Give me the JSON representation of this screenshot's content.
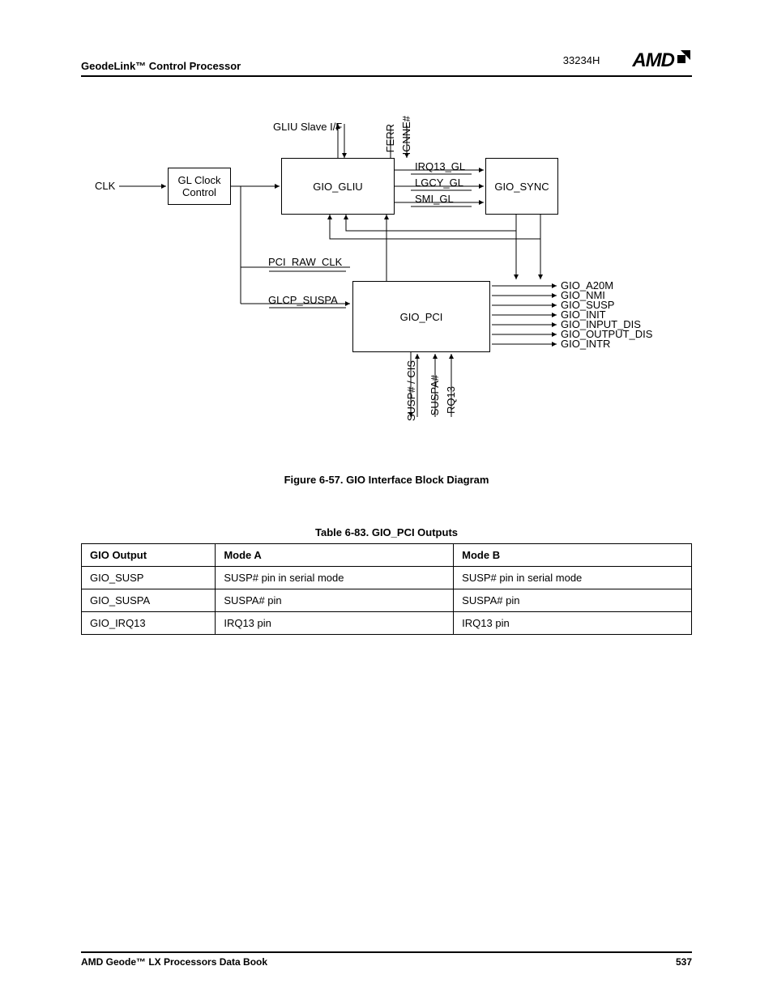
{
  "header": {
    "title": "GeodeLink™ Control Processor",
    "docnum": "33234H",
    "logo": "AMD"
  },
  "diagram": {
    "blocks": {
      "glclock": "GL Clock\nControl",
      "gio_gliu": "GIO_GLIU",
      "gio_sync": "GIO_SYNC",
      "gio_pci": "GIO_PCI"
    },
    "labels": {
      "clk": "CLK",
      "gliu_slave": "GLIU Slave I/F",
      "ferr": "FERR",
      "ignne": "IGNNE#",
      "irq13_gl": "IRQ13_GL",
      "lgcy_gl": "LGCY_GL",
      "smi_gl": "SMI_GL",
      "pci_raw_clk": "PCI_RAW_CLK",
      "glcp_suspa": "GLCP_SUSPA",
      "gio_a20m": "GIO_A20M",
      "gio_nmi": "GIO_NMI",
      "gio_susp": "GIO_SUSP",
      "gio_init": "GIO_INIT",
      "gio_input_dis": "GIO_INPUT_DIS",
      "gio_output_dis": "GIO_OUTPUT_DIS",
      "gio_intr": "GIO_INTR",
      "susp_cis": "SUSP# / CIS",
      "suspa": "SUSPA#",
      "rq13": "RQ13"
    }
  },
  "figure": {
    "caption": "Figure 6-57.  GIO Interface Block Diagram"
  },
  "table": {
    "caption": "Table 6-83.  GIO_PCI Outputs",
    "headers": [
      "GIO Output",
      "Mode A",
      "Mode B"
    ],
    "rows": [
      [
        "GIO_SUSP",
        "SUSP# pin in serial mode",
        "SUSP# pin in serial mode"
      ],
      [
        "GIO_SUSPA",
        "SUSPA# pin",
        "SUSPA# pin"
      ],
      [
        "GIO_IRQ13",
        "IRQ13 pin",
        "IRQ13 pin"
      ]
    ]
  },
  "footer": {
    "book": "AMD Geode™ LX Processors Data Book",
    "page": "537"
  }
}
